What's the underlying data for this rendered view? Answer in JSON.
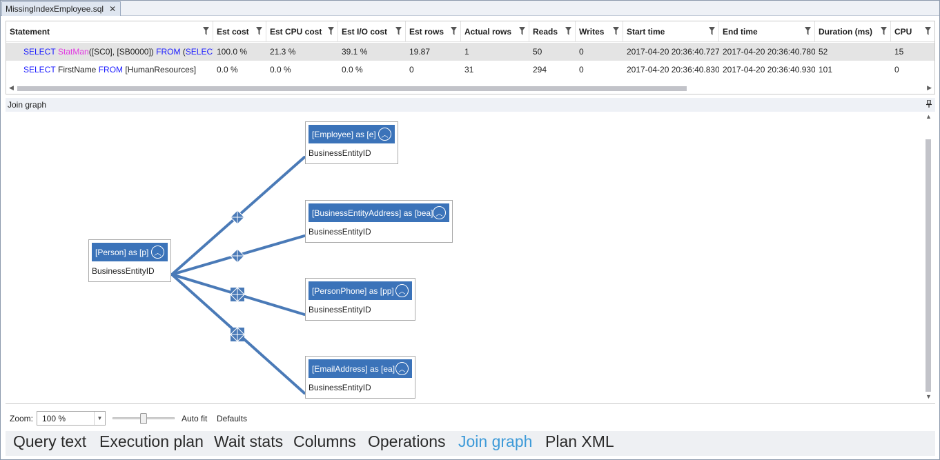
{
  "document_tab": {
    "title": "MissingIndexEmployee.sql",
    "close_glyph": "✕"
  },
  "grid": {
    "columns": [
      "Statement",
      "Est cost",
      "Est CPU cost",
      "Est I/O cost",
      "Est rows",
      "Actual rows",
      "Reads",
      "Writes",
      "Start time",
      "End time",
      "Duration (ms)",
      "CPU"
    ],
    "rows": [
      {
        "selected": true,
        "statement": {
          "kw1": "SELECT",
          "fn": "StatMan",
          "rest": "([SC0], [SB0000])",
          "kw2": "FROM",
          "rest2": "(",
          "kw3": "SELECT"
        },
        "est_cost": "100.0 %",
        "est_cpu_cost": "21.3 %",
        "est_io_cost": "39.1 %",
        "est_rows": "19.87",
        "actual_rows": "1",
        "reads": "50",
        "writes": "0",
        "start_time": "2017-04-20 20:36:40.727",
        "end_time": "2017-04-20 20:36:40.780",
        "duration": "52",
        "cpu": "15"
      },
      {
        "selected": false,
        "statement": {
          "kw1": "SELECT",
          "text1": " FirstName ",
          "kw2": "FROM",
          "text2": " [HumanResources]"
        },
        "est_cost": "0.0 %",
        "est_cpu_cost": "0.0 %",
        "est_io_cost": "0.0 %",
        "est_rows": "0",
        "actual_rows": "31",
        "reads": "294",
        "writes": "0",
        "start_time": "2017-04-20 20:36:40.830",
        "end_time": "2017-04-20 20:36:40.930",
        "duration": "101",
        "cpu": "0"
      }
    ]
  },
  "join_graph": {
    "panel_title": "Join graph",
    "pin_glyph": "📌",
    "tables": [
      {
        "header": "[Person] as [p]",
        "column": "BusinessEntityID"
      },
      {
        "header": "[Employee] as [e]",
        "column": "BusinessEntityID"
      },
      {
        "header": "[BusinessEntityAddress] as [bea]",
        "column": "BusinessEntityID"
      },
      {
        "header": "[PersonPhone] as [pp]",
        "column": "BusinessEntityID"
      },
      {
        "header": "[EmailAddress] as [ea]",
        "column": "BusinessEntityID"
      }
    ],
    "edge_color": "#4a7ab7"
  },
  "zoom": {
    "label": "Zoom:",
    "value": "100 %",
    "zoom_level_percent": 50,
    "autofit": "Auto fit",
    "defaults": "Defaults"
  },
  "bottom_tabs": [
    "Query text",
    "Execution plan",
    "Wait stats",
    "Columns",
    "Operations",
    "Join graph",
    "Plan XML"
  ],
  "active_bottom_tab": "Join graph"
}
